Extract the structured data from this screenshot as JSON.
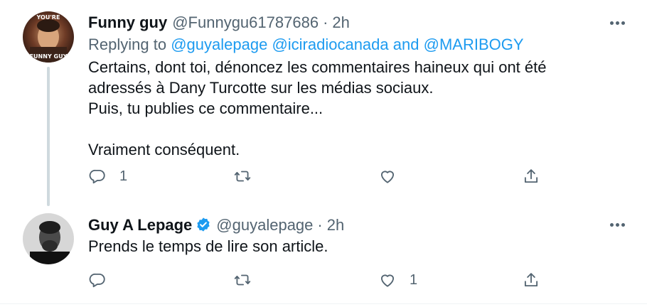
{
  "tweets": [
    {
      "display_name": "Funny guy",
      "handle": "@Funnygu61787686",
      "separator": "·",
      "time": "2h",
      "replying_prefix": "Replying to",
      "replying_to": [
        "@guyalepage",
        "@iciradiocanada"
      ],
      "replying_and": "and",
      "replying_last": "@MARIBOGY",
      "text_lines": [
        "Certains, dont toi, dénoncez les commentaires haineux qui ont été",
        "adressés à Dany Turcotte sur les médias sociaux.",
        "Puis, tu publies ce commentaire...",
        "",
        "Vraiment conséquent."
      ],
      "reply_count": "1",
      "retweet_count": "",
      "like_count": "",
      "avatar_text_top": "YOU'RE",
      "avatar_text_bottom": "FUNNY GUY"
    },
    {
      "display_name": "Guy A Lepage",
      "verified": true,
      "handle": "@guyalepage",
      "separator": "·",
      "time": "2h",
      "text_lines": [
        "Prends le temps de lire son article."
      ],
      "reply_count": "",
      "retweet_count": "",
      "like_count": "1"
    }
  ],
  "colors": {
    "link": "#1d9bf0",
    "secondary_text": "#536471",
    "primary_text": "#0f1419",
    "thread_line": "#cfd9de",
    "verified_badge": "#1d9bf0"
  },
  "icons": [
    "reply-icon",
    "retweet-icon",
    "like-icon",
    "share-icon",
    "more-icon",
    "verified-badge-icon"
  ]
}
